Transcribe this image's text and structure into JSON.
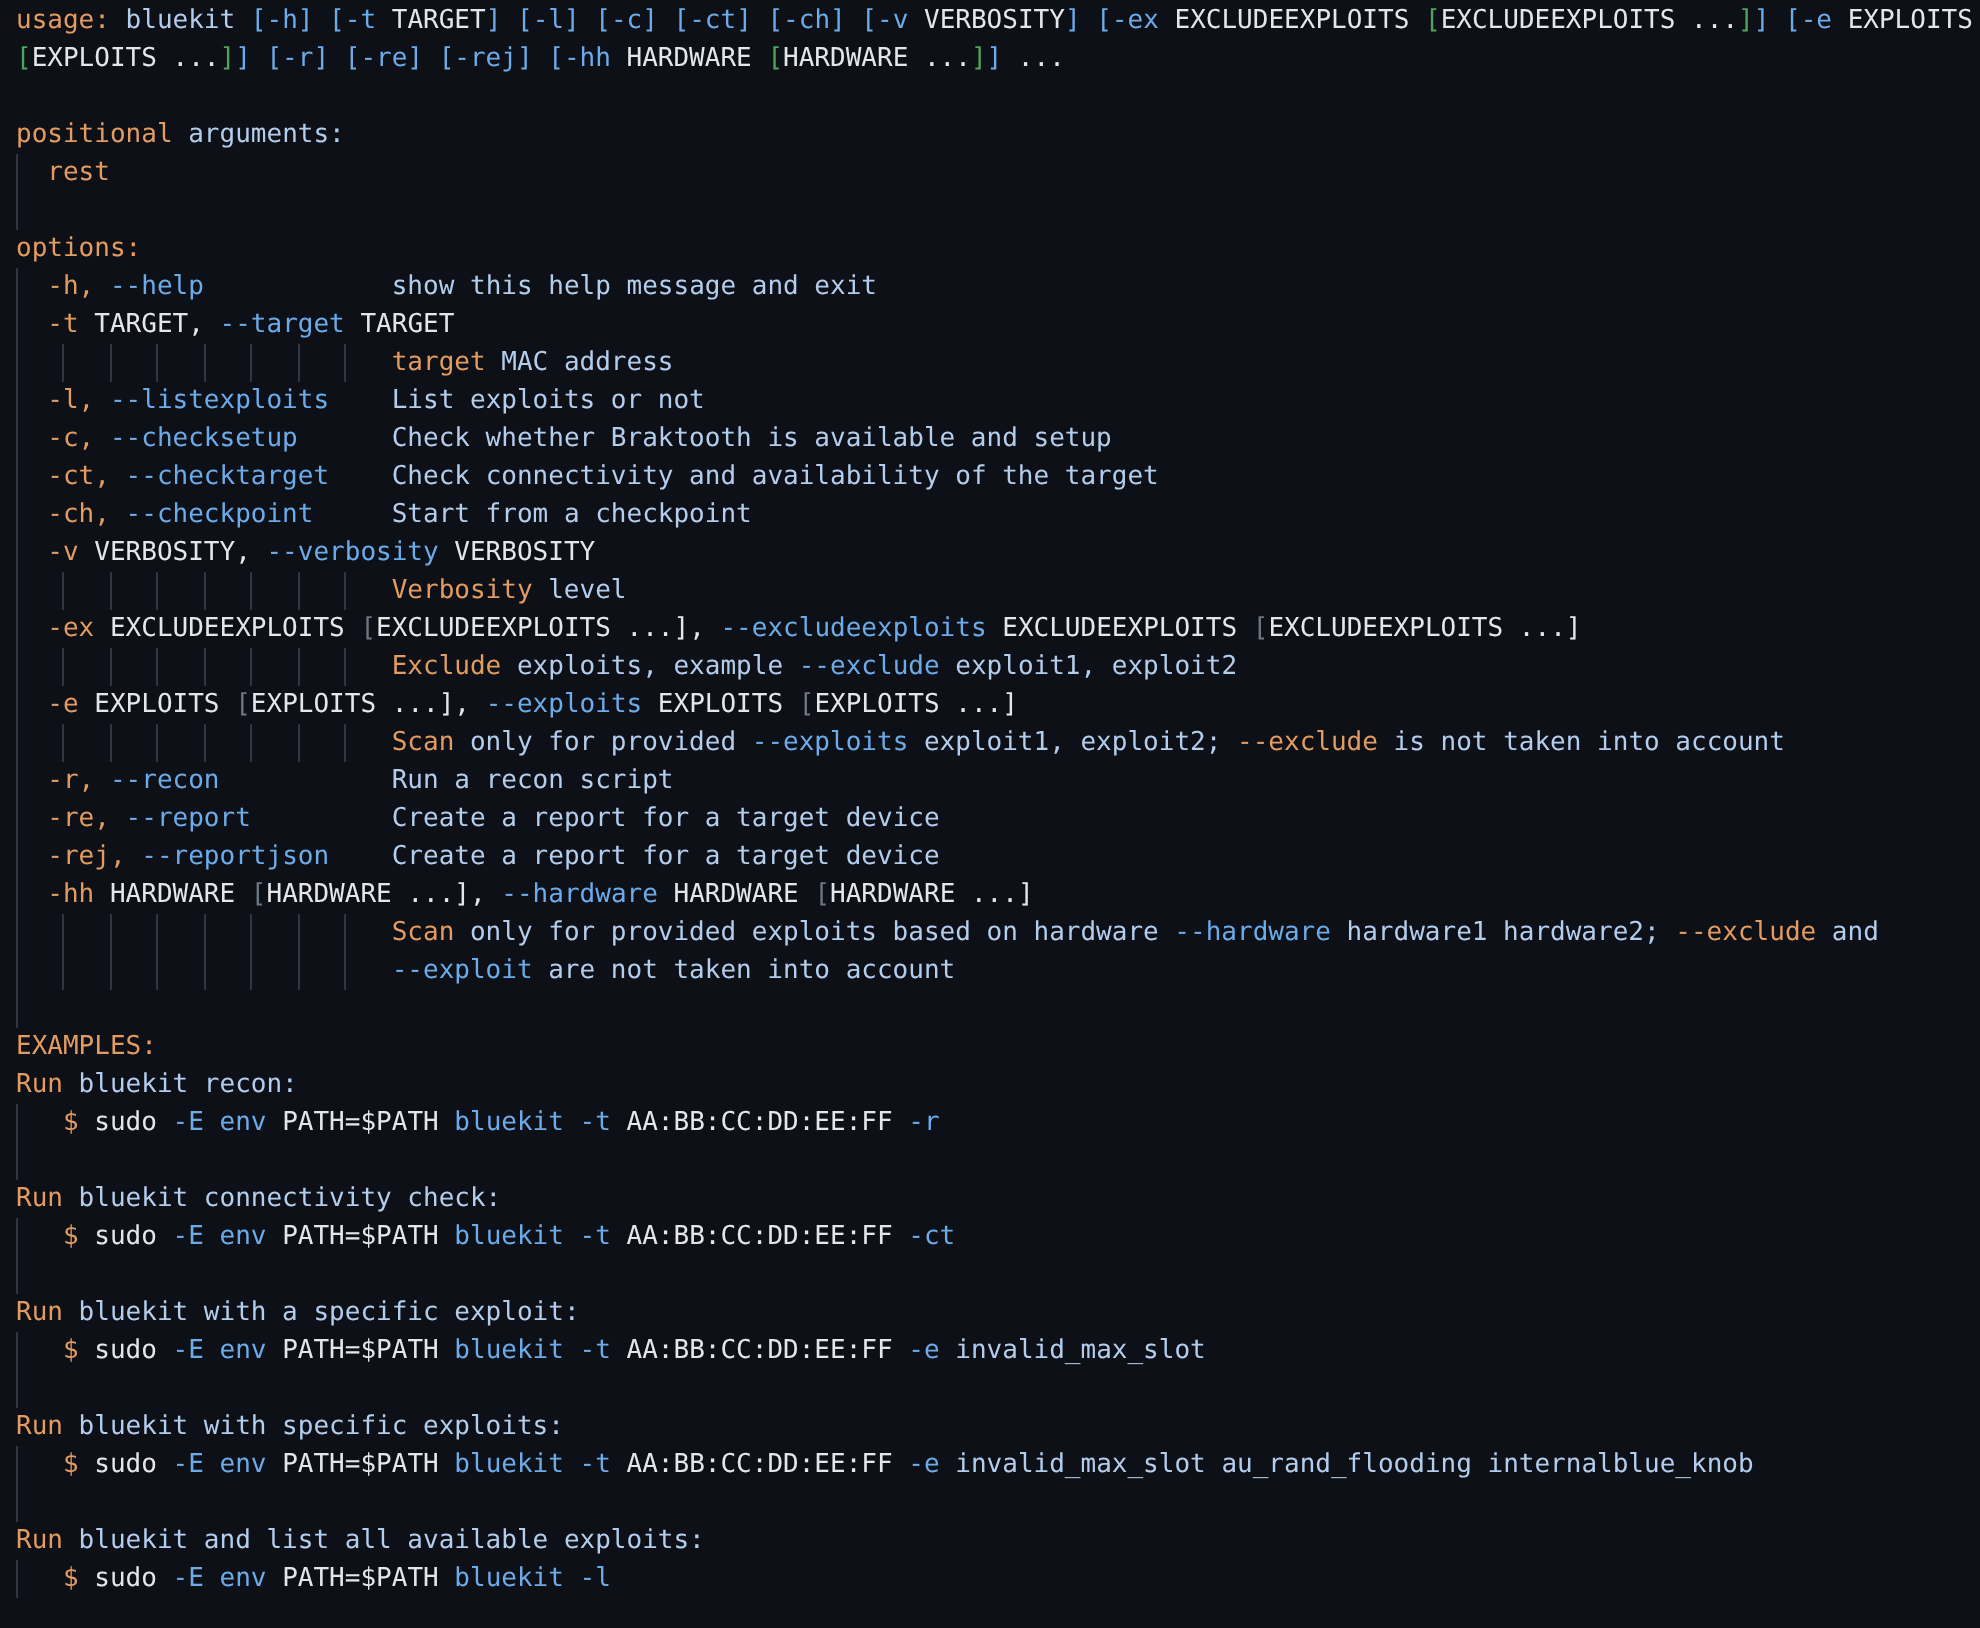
{
  "lines": [
    {
      "kind": "text",
      "segments": [
        {
          "kind": "k",
          "text": "usage:"
        },
        {
          "kind": "t",
          "text": " bluekit "
        },
        {
          "kind": "f",
          "text": "[-h] [-t "
        },
        {
          "kind": "m",
          "text": "TARGET"
        },
        {
          "kind": "f",
          "text": "] [-l] [-c] [-ct] [-ch] [-v "
        },
        {
          "kind": "m",
          "text": "VERBOSITY"
        },
        {
          "kind": "f",
          "text": "] [-ex "
        },
        {
          "kind": "m",
          "text": "EXCLUDEEXPLOITS "
        },
        {
          "kind": "g",
          "text": "["
        },
        {
          "kind": "m",
          "text": "EXCLUDEEXPLOITS ..."
        },
        {
          "kind": "g",
          "text": "]"
        },
        {
          "kind": "f",
          "text": "] [-e "
        },
        {
          "kind": "m",
          "text": "EXPLOITS"
        }
      ]
    },
    {
      "kind": "text",
      "segments": [
        {
          "kind": "g",
          "text": "["
        },
        {
          "kind": "m",
          "text": "EXPLOITS ..."
        },
        {
          "kind": "g",
          "text": "]"
        },
        {
          "kind": "f",
          "text": "] [-r] [-re] [-rej] [-hh "
        },
        {
          "kind": "m",
          "text": "HARDWARE "
        },
        {
          "kind": "g",
          "text": "["
        },
        {
          "kind": "m",
          "text": "HARDWARE ..."
        },
        {
          "kind": "g",
          "text": "]"
        },
        {
          "kind": "f",
          "text": "]"
        },
        {
          "kind": "m",
          "text": " ..."
        }
      ]
    },
    {
      "kind": "blank"
    },
    {
      "kind": "text",
      "segments": [
        {
          "kind": "k",
          "text": "positional"
        },
        {
          "kind": "t",
          "text": " arguments:"
        }
      ]
    },
    {
      "kind": "text",
      "segments": [
        {
          "kind": "k",
          "text": "  rest"
        }
      ]
    },
    {
      "kind": "blank"
    },
    {
      "kind": "text",
      "segments": [
        {
          "kind": "k",
          "text": "options:"
        }
      ]
    },
    {
      "kind": "text",
      "segments": [
        {
          "kind": "k",
          "text": "  -h,"
        },
        {
          "kind": "f",
          "text": " --help"
        },
        {
          "kind": "t",
          "text": "            show this help message and exit"
        }
      ]
    },
    {
      "kind": "text",
      "segments": [
        {
          "kind": "k",
          "text": "  -t"
        },
        {
          "kind": "m",
          "text": " TARGET,"
        },
        {
          "kind": "f",
          "text": " --target"
        },
        {
          "kind": "m",
          "text": " TARGET"
        }
      ]
    },
    {
      "kind": "text",
      "segments": [
        {
          "kind": "k",
          "text": "                        target"
        },
        {
          "kind": "t",
          "text": " MAC address"
        }
      ]
    },
    {
      "kind": "text",
      "segments": [
        {
          "kind": "k",
          "text": "  -l,"
        },
        {
          "kind": "f",
          "text": " --listexploits"
        },
        {
          "kind": "t",
          "text": "    List exploits or not"
        }
      ]
    },
    {
      "kind": "text",
      "segments": [
        {
          "kind": "k",
          "text": "  -c,"
        },
        {
          "kind": "f",
          "text": " --checksetup"
        },
        {
          "kind": "t",
          "text": "      Check whether Braktooth is available and setup"
        }
      ]
    },
    {
      "kind": "text",
      "segments": [
        {
          "kind": "k",
          "text": "  -ct,"
        },
        {
          "kind": "f",
          "text": " --checktarget"
        },
        {
          "kind": "t",
          "text": "    Check connectivity and availability of the target"
        }
      ]
    },
    {
      "kind": "text",
      "segments": [
        {
          "kind": "k",
          "text": "  -ch,"
        },
        {
          "kind": "f",
          "text": " --checkpoint"
        },
        {
          "kind": "t",
          "text": "     Start from a checkpoint"
        }
      ]
    },
    {
      "kind": "text",
      "segments": [
        {
          "kind": "k",
          "text": "  -v"
        },
        {
          "kind": "m",
          "text": " VERBOSITY,"
        },
        {
          "kind": "f",
          "text": " --verbosity"
        },
        {
          "kind": "m",
          "text": " VERBOSITY"
        }
      ]
    },
    {
      "kind": "text",
      "segments": [
        {
          "kind": "k",
          "text": "                        Verbosity"
        },
        {
          "kind": "t",
          "text": " level"
        }
      ]
    },
    {
      "kind": "text",
      "segments": [
        {
          "kind": "k",
          "text": "  -ex"
        },
        {
          "kind": "m",
          "text": " EXCLUDEEXPLOITS "
        },
        {
          "kind": "d",
          "text": "["
        },
        {
          "kind": "m",
          "text": "EXCLUDEEXPLOITS ...],"
        },
        {
          "kind": "f",
          "text": " --excludeexploits"
        },
        {
          "kind": "m",
          "text": " EXCLUDEEXPLOITS "
        },
        {
          "kind": "d",
          "text": "["
        },
        {
          "kind": "m",
          "text": "EXCLUDEEXPLOITS ...]"
        }
      ]
    },
    {
      "kind": "text",
      "segments": [
        {
          "kind": "k",
          "text": "                        Exclude"
        },
        {
          "kind": "t",
          "text": " exploits, example"
        },
        {
          "kind": "f",
          "text": " --exclude"
        },
        {
          "kind": "t",
          "text": " exploit1, exploit2"
        }
      ]
    },
    {
      "kind": "text",
      "segments": [
        {
          "kind": "k",
          "text": "  -e"
        },
        {
          "kind": "m",
          "text": " EXPLOITS "
        },
        {
          "kind": "d",
          "text": "["
        },
        {
          "kind": "m",
          "text": "EXPLOITS ...],"
        },
        {
          "kind": "f",
          "text": " --exploits"
        },
        {
          "kind": "m",
          "text": " EXPLOITS "
        },
        {
          "kind": "d",
          "text": "["
        },
        {
          "kind": "m",
          "text": "EXPLOITS ...]"
        }
      ]
    },
    {
      "kind": "text",
      "segments": [
        {
          "kind": "k",
          "text": "                        Scan"
        },
        {
          "kind": "t",
          "text": " only for provided"
        },
        {
          "kind": "f",
          "text": " --exploits"
        },
        {
          "kind": "t",
          "text": " exploit1, exploit2;"
        },
        {
          "kind": "k",
          "text": " --exclude"
        },
        {
          "kind": "t",
          "text": " is not taken into account"
        }
      ]
    },
    {
      "kind": "text",
      "segments": [
        {
          "kind": "k",
          "text": "  -r,"
        },
        {
          "kind": "f",
          "text": " --recon"
        },
        {
          "kind": "t",
          "text": "           Run a recon script"
        }
      ]
    },
    {
      "kind": "text",
      "segments": [
        {
          "kind": "k",
          "text": "  -re,"
        },
        {
          "kind": "f",
          "text": " --report"
        },
        {
          "kind": "t",
          "text": "         Create a report for a target device"
        }
      ]
    },
    {
      "kind": "text",
      "segments": [
        {
          "kind": "k",
          "text": "  -rej,"
        },
        {
          "kind": "f",
          "text": " --reportjson"
        },
        {
          "kind": "t",
          "text": "    Create a report for a target device"
        }
      ]
    },
    {
      "kind": "text",
      "segments": [
        {
          "kind": "k",
          "text": "  -hh"
        },
        {
          "kind": "m",
          "text": " HARDWARE "
        },
        {
          "kind": "d",
          "text": "["
        },
        {
          "kind": "m",
          "text": "HARDWARE ...],"
        },
        {
          "kind": "f",
          "text": " --hardware"
        },
        {
          "kind": "m",
          "text": " HARDWARE "
        },
        {
          "kind": "d",
          "text": "["
        },
        {
          "kind": "m",
          "text": "HARDWARE ...]"
        }
      ]
    },
    {
      "kind": "text",
      "segments": [
        {
          "kind": "k",
          "text": "                        Scan"
        },
        {
          "kind": "t",
          "text": " only for provided exploits based on hardware"
        },
        {
          "kind": "f",
          "text": " --hardware"
        },
        {
          "kind": "t",
          "text": " hardware1 hardware2;"
        },
        {
          "kind": "k",
          "text": " --exclude"
        },
        {
          "kind": "t",
          "text": " and"
        }
      ]
    },
    {
      "kind": "text",
      "segments": [
        {
          "kind": "f",
          "text": "                        --exploit"
        },
        {
          "kind": "t",
          "text": " are not taken into account"
        }
      ]
    },
    {
      "kind": "blank"
    },
    {
      "kind": "text",
      "segments": [
        {
          "kind": "k",
          "text": "EXAMPLES:"
        }
      ]
    },
    {
      "kind": "text",
      "segments": [
        {
          "kind": "k",
          "text": "Run"
        },
        {
          "kind": "t",
          "text": " bluekit recon:"
        }
      ]
    },
    {
      "kind": "text",
      "segments": [
        {
          "kind": "k",
          "text": "   $"
        },
        {
          "kind": "m",
          "text": " sudo"
        },
        {
          "kind": "f",
          "text": " -E env"
        },
        {
          "kind": "m",
          "text": " PATH=$PATH"
        },
        {
          "kind": "f",
          "text": " bluekit -t"
        },
        {
          "kind": "m",
          "text": " AA:BB:CC:DD:EE:FF"
        },
        {
          "kind": "f",
          "text": " -r"
        }
      ]
    },
    {
      "kind": "blank"
    },
    {
      "kind": "text",
      "segments": [
        {
          "kind": "k",
          "text": "Run"
        },
        {
          "kind": "t",
          "text": " bluekit connectivity check:"
        }
      ]
    },
    {
      "kind": "text",
      "segments": [
        {
          "kind": "k",
          "text": "   $"
        },
        {
          "kind": "m",
          "text": " sudo"
        },
        {
          "kind": "f",
          "text": " -E env"
        },
        {
          "kind": "m",
          "text": " PATH=$PATH"
        },
        {
          "kind": "f",
          "text": " bluekit -t"
        },
        {
          "kind": "m",
          "text": " AA:BB:CC:DD:EE:FF"
        },
        {
          "kind": "f",
          "text": " -ct"
        }
      ]
    },
    {
      "kind": "blank"
    },
    {
      "kind": "text",
      "segments": [
        {
          "kind": "k",
          "text": "Run"
        },
        {
          "kind": "t",
          "text": " bluekit with a specific exploit:"
        }
      ]
    },
    {
      "kind": "text",
      "segments": [
        {
          "kind": "k",
          "text": "   $"
        },
        {
          "kind": "m",
          "text": " sudo"
        },
        {
          "kind": "f",
          "text": " -E env"
        },
        {
          "kind": "m",
          "text": " PATH=$PATH"
        },
        {
          "kind": "f",
          "text": " bluekit -t"
        },
        {
          "kind": "m",
          "text": " AA:BB:CC:DD:EE:FF"
        },
        {
          "kind": "f",
          "text": " -e"
        },
        {
          "kind": "t",
          "text": " invalid_max_slot"
        }
      ]
    },
    {
      "kind": "blank"
    },
    {
      "kind": "text",
      "segments": [
        {
          "kind": "k",
          "text": "Run"
        },
        {
          "kind": "t",
          "text": " bluekit with specific exploits:"
        }
      ]
    },
    {
      "kind": "text",
      "segments": [
        {
          "kind": "k",
          "text": "   $"
        },
        {
          "kind": "m",
          "text": " sudo"
        },
        {
          "kind": "f",
          "text": " -E env"
        },
        {
          "kind": "m",
          "text": " PATH=$PATH"
        },
        {
          "kind": "f",
          "text": " bluekit -t"
        },
        {
          "kind": "m",
          "text": " AA:BB:CC:DD:EE:FF"
        },
        {
          "kind": "f",
          "text": " -e"
        },
        {
          "kind": "t",
          "text": " invalid_max_slot au_rand_flooding internalblue_knob"
        }
      ]
    },
    {
      "kind": "blank"
    },
    {
      "kind": "text",
      "segments": [
        {
          "kind": "k",
          "text": "Run"
        },
        {
          "kind": "t",
          "text": " bluekit and list all available exploits:"
        }
      ]
    },
    {
      "kind": "text",
      "segments": [
        {
          "kind": "k",
          "text": "   $"
        },
        {
          "kind": "m",
          "text": " sudo"
        },
        {
          "kind": "f",
          "text": " -E env"
        },
        {
          "kind": "m",
          "text": " PATH=$PATH"
        },
        {
          "kind": "f",
          "text": " bluekit -l"
        }
      ]
    }
  ]
}
